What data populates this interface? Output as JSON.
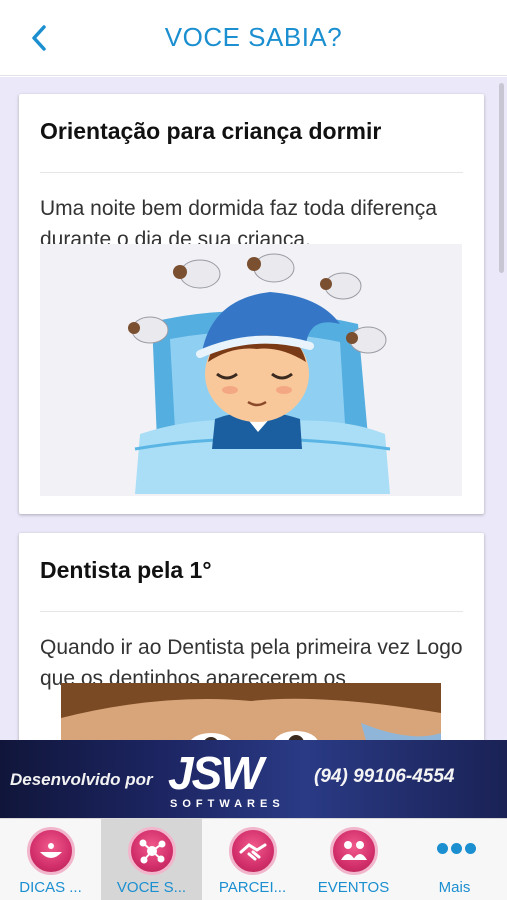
{
  "header": {
    "title": "VOCE SABIA?"
  },
  "cards": [
    {
      "title": "Orientação para criança dormir",
      "text": "Uma noite bem dormida faz toda diferença durante o dia de sua criança."
    },
    {
      "title": "Dentista pela 1°",
      "text": "Quando ir ao Dentista pela primeira vez Logo que os dentinhos aparecerem os"
    }
  ],
  "banner": {
    "developed_by": "Desenvolvido por",
    "logo": "JSW",
    "logo_sub": "SOFTWARES",
    "phone": "(94) 99106-4554"
  },
  "tabs": [
    {
      "label": "DICAS ...",
      "icon": "bowl-icon"
    },
    {
      "label": "VOCE S...",
      "icon": "molecule-icon"
    },
    {
      "label": "PARCEI...",
      "icon": "handshake-icon"
    },
    {
      "label": "EVENTOS",
      "icon": "people-icon"
    },
    {
      "label": "Mais",
      "icon": "more-dots-icon"
    }
  ],
  "colors": {
    "accent": "#1b8fd0",
    "tab_icon": "#d22f6a",
    "background": "#ebe9f9"
  }
}
